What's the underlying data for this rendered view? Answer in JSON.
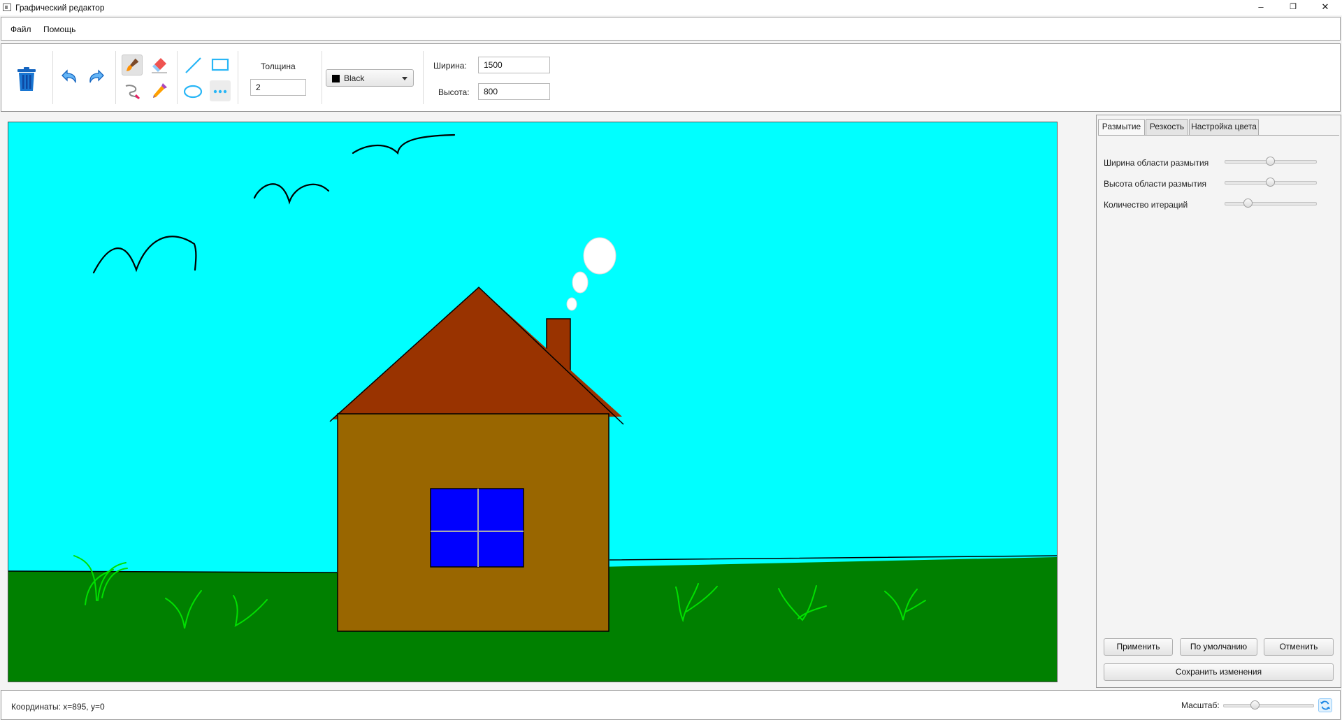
{
  "window": {
    "title": "Графический редактор",
    "minimize": "–",
    "maximize": "❐",
    "close": "✕"
  },
  "menu": {
    "file": "Файл",
    "help": "Помощь"
  },
  "toolbar": {
    "tools": [
      "clear-canvas",
      "undo",
      "redo",
      "brush",
      "eraser",
      "line",
      "rectangle",
      "lasso",
      "color-picker",
      "ellipse",
      "more"
    ],
    "selected_tool": "brush",
    "thickness_label": "Толщина",
    "thickness_value": "2",
    "color_name": "Black",
    "color_hex": "#000000",
    "width_label": "Ширина:",
    "width_value": "1500",
    "height_label": "Высота:",
    "height_value": "800"
  },
  "canvas": {
    "colors": {
      "sky": "#00ffff",
      "grass": "#008000",
      "wall": "#996600",
      "roof": "#993300",
      "window": "#0000ff",
      "blades": "#00e000",
      "smoke": "#ffffff"
    }
  },
  "panel": {
    "tabs": [
      "Размытие",
      "Резкость",
      "Настройка цвета"
    ],
    "active_tab": 0,
    "sliders": [
      {
        "label": "Ширина области размытия",
        "value": 0.5
      },
      {
        "label": "Высота области размытия",
        "value": 0.5
      },
      {
        "label": "Количество итераций",
        "value": 0.25
      }
    ],
    "apply": "Применить",
    "defaults": "По умолчанию",
    "cancel": "Отменить",
    "save": "Сохранить изменения"
  },
  "status": {
    "coords": "Координаты: x=895, y=0",
    "zoom_label": "Масштаб:",
    "zoom_value": 0.35
  }
}
